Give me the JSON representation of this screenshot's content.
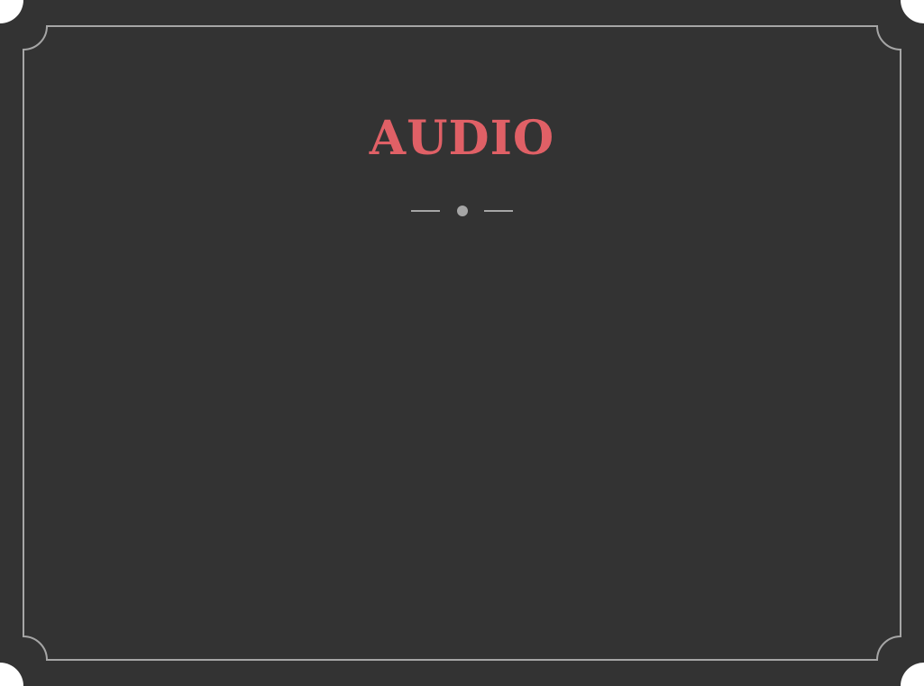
{
  "slide": {
    "title": "AUDIO"
  },
  "colors": {
    "background": "#333333",
    "corner_cutout": "#ffffff",
    "frame_line": "#a6a6a6",
    "title": "#e06066",
    "ornament": "#a6a6a6"
  },
  "icons": {
    "ornament": "line-dot-line-divider-icon"
  }
}
